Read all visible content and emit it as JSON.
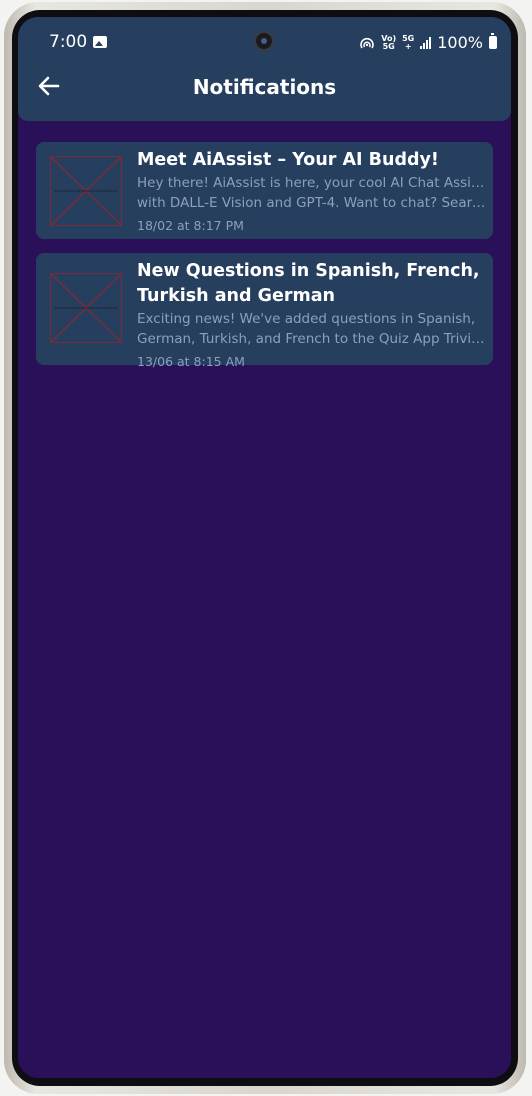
{
  "status_bar": {
    "time": "7:00",
    "battery": "100%",
    "network_top": "Vo)",
    "network_bottom": "5G",
    "network2_top": "5G",
    "network2_bottom": "+"
  },
  "header": {
    "title": "Notifications"
  },
  "notifications": [
    {
      "title": "Meet AiAssist – Your AI Buddy!",
      "body_line1": "Hey there! AiAssist is here, your cool AI Chat Assistant",
      "body_line2": "with DALL-E Vision and GPT-4. Want to chat? Searc...",
      "date": "18/02 at  8:17 PM"
    },
    {
      "title_line1": "New Questions in Spanish, French,",
      "title_line2": "Turkish and German",
      "body_line1": "Exciting news! We've added questions in Spanish,",
      "body_line2": "German, Turkish, and French to the Quiz App Trivia. ...",
      "date": "13/06 at  8:15 AM"
    }
  ],
  "colors": {
    "background": "#2a1059",
    "header": "#273f5e",
    "card": "#273f5e",
    "secondary_text": "#8ba0b9"
  }
}
